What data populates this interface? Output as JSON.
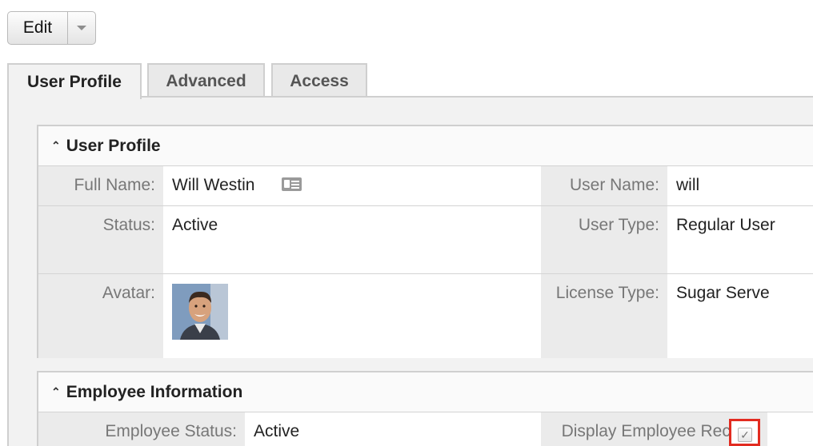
{
  "actions": {
    "edit_label": "Edit",
    "dropdown_icon": "caret-down-icon"
  },
  "tabs": [
    {
      "label": "User Profile",
      "active": true
    },
    {
      "label": "Advanced",
      "active": false
    },
    {
      "label": "Access",
      "active": false
    }
  ],
  "sections": {
    "user_profile": {
      "title": "User Profile",
      "collapse_icon": "double-chevron-up-icon",
      "fields": {
        "full_name": {
          "label": "Full Name:",
          "value": "Will Westin",
          "icon": "vcard-icon"
        },
        "user_name": {
          "label": "User Name:",
          "value": "will"
        },
        "status": {
          "label": "Status:",
          "value": "Active"
        },
        "user_type": {
          "label": "User Type:",
          "value": "Regular User"
        },
        "avatar": {
          "label": "Avatar:"
        },
        "license_type": {
          "label": "License Type:",
          "value": "Sugar Serve"
        }
      }
    },
    "employee_information": {
      "title": "Employee Information",
      "collapse_icon": "double-chevron-up-icon",
      "fields": {
        "employee_status": {
          "label": "Employee Status:",
          "value": "Active"
        },
        "display_employee_record": {
          "label": "Display Employee Record:",
          "checked": true
        }
      }
    }
  },
  "colors": {
    "highlight": "#e22b20",
    "label_bg": "#ebebeb",
    "panel_bg": "#f2f2f2"
  }
}
